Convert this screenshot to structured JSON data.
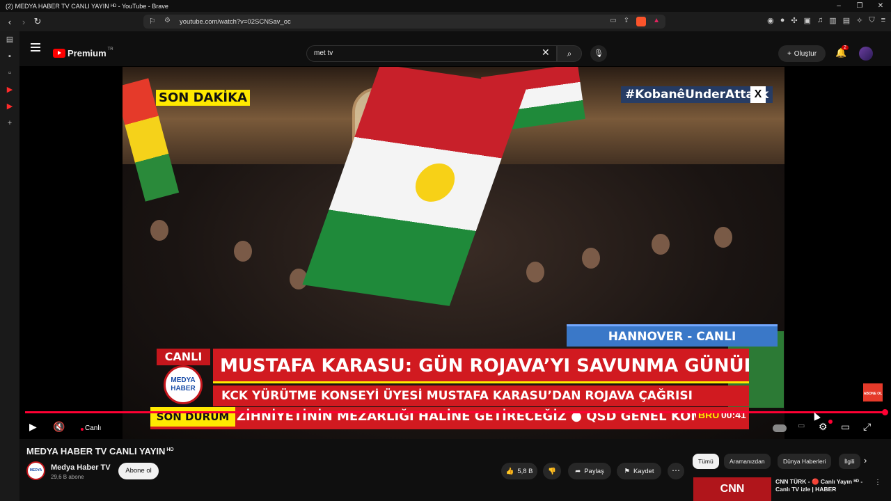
{
  "window": {
    "title": "(2) MEDYA HABER TV CANLI YAYIN ᴴᴰ - YouTube - Brave",
    "controls": [
      "–",
      "❐",
      "✕"
    ]
  },
  "browser": {
    "url": "youtube.com/watch?v=02SCNSav_oc"
  },
  "youtube": {
    "logo_text": "Premium",
    "logo_region": "TR",
    "search_value": "met tv",
    "create_label": "Oluştur",
    "notification_count": "2"
  },
  "video": {
    "overlay_son_dakika": "SON DAKİKA",
    "overlay_hashtag": "#KobanêUnderAttack",
    "overlay_location": "HANNOVER - CANLI",
    "overlay_canli": "CANLI",
    "logo_text_1": "MEDYA",
    "logo_text_2": "HABER",
    "headline": "MUSTAFA KARASU: GÜN ROJAVA’YI SAVUNMA GÜNÜDÜR",
    "subheadline": "KCK YÜRÜTME KONSEYİ ÜYESİ MUSTAFA KARASU’DAN ROJAVA ÇAĞRISI",
    "ticker_label": "SON DURUM",
    "ticker_text": "ZİHNİYETİNİN MEZARLIĞI HALİNE GETİRECEĞİZ ● QSD GENEL KOMU",
    "clock_city": "BRU",
    "clock_time": "00:41",
    "abone_badge": "ABONE OL",
    "progress": 1.0,
    "live_label": "Canlı"
  },
  "details": {
    "title": "MEDYA HABER TV CANLI YAYIN",
    "title_badge": "HD",
    "channel_name": "Medya Haber TV",
    "subscribers": "29,6 B abone",
    "subscribe_label": "Abone ol",
    "like_count": "5,8 B",
    "share_label": "Paylaş",
    "save_label": "Kaydet"
  },
  "chips": [
    "Tümü",
    "Aramanızdan",
    "Dünya Haberleri",
    "İlgili"
  ],
  "recommendation": {
    "thumb_text": "CNN",
    "title": "CNN TÜRK - 🔴 Canlı Yayın ᴴᴰ - Canlı TV izle | HABER"
  },
  "colors": {
    "accent": "#ff0033",
    "banner_red": "#d11a20",
    "banner_yellow": "#ffe900"
  }
}
